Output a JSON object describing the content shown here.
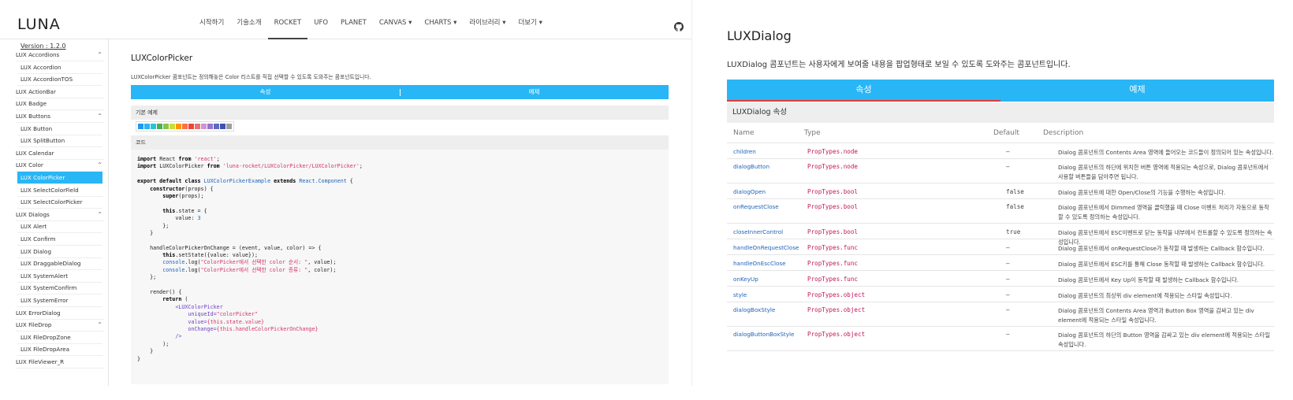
{
  "left": {
    "logo": "LUNA",
    "nav": [
      "시작하기",
      "기술소개",
      "ROCKET",
      "UFO",
      "PLANET",
      "CANVAS ▾",
      "CHARTS ▾",
      "라이브러리 ▾",
      "더보기 ▾"
    ],
    "nav_active_index": 2,
    "version": "Version : 1.2.0",
    "sidebar": [
      {
        "label": "LUX Accordions",
        "child": false,
        "chevron": "⌃"
      },
      {
        "label": "LUX Accordion",
        "child": true
      },
      {
        "label": "LUX AccordionTOS",
        "child": true
      },
      {
        "label": "LUX ActionBar",
        "child": false
      },
      {
        "label": "LUX Badge",
        "child": false
      },
      {
        "label": "LUX Buttons",
        "child": false,
        "chevron": "⌃"
      },
      {
        "label": "LUX Button",
        "child": true
      },
      {
        "label": "LUX SplitButton",
        "child": true
      },
      {
        "label": "LUX Calendar",
        "child": false
      },
      {
        "label": "LUX Color",
        "child": false,
        "chevron": "⌃"
      },
      {
        "label": "LUX ColorPicker",
        "child": true,
        "active": true
      },
      {
        "label": "LUX SelectColorField",
        "child": true
      },
      {
        "label": "LUX SelectColorPicker",
        "child": true
      },
      {
        "label": "LUX Dialogs",
        "child": false,
        "chevron": "⌃"
      },
      {
        "label": "LUX Alert",
        "child": true
      },
      {
        "label": "LUX Confirm",
        "child": true
      },
      {
        "label": "LUX Dialog",
        "child": true
      },
      {
        "label": "LUX DraggableDialog",
        "child": true
      },
      {
        "label": "LUX SystemAlert",
        "child": true
      },
      {
        "label": "LUX SystemConfirm",
        "child": true
      },
      {
        "label": "LUX SystemError",
        "child": true
      },
      {
        "label": "LUX ErrorDialog",
        "child": false
      },
      {
        "label": "LUX FileDrop",
        "child": false,
        "chevron": "⌃"
      },
      {
        "label": "LUX FileDropZone",
        "child": true
      },
      {
        "label": "LUX FileDropArea",
        "child": true
      },
      {
        "label": "LUX FileViewer_R",
        "child": false
      }
    ],
    "content": {
      "title": "LUXColorPicker",
      "description": "LUXColorPicker 콤포넌트는 정의해놓은 Color 리스트를 직접 선택할 수 있도록 도와주는 콤포넌트입니다.",
      "tab_props": "속성",
      "tab_example": "예제",
      "basic_example": "기본 예제",
      "code_label": "코드",
      "swatch_colors": [
        "#2196f3",
        "#29b6f6",
        "#26c6da",
        "#4caf50",
        "#8bc34a",
        "#cddc39",
        "#ff9800",
        "#ff7043",
        "#f44336",
        "#e57373",
        "#ce93d8",
        "#9575cd",
        "#5c6bc0",
        "#3f51b5",
        "#9e9e9e"
      ],
      "code_lines": [
        [
          [
            "k",
            "import"
          ],
          [
            "t",
            " React "
          ],
          [
            "k",
            "from"
          ],
          [
            "s",
            " 'react'"
          ],
          [
            "t",
            ";"
          ]
        ],
        [
          [
            "k",
            "import"
          ],
          [
            "t",
            " LUXColorPicker "
          ],
          [
            "k",
            "from"
          ],
          [
            "s",
            " 'luna-rocket/LUXColorPicker/LUXColorPicker'"
          ],
          [
            "t",
            ";"
          ]
        ],
        [],
        [
          [
            "k",
            "export default class"
          ],
          [
            "c",
            " LUXColorPickerExample "
          ],
          [
            "k",
            "extends"
          ],
          [
            "c",
            " React.Component"
          ],
          [
            "t",
            " {"
          ]
        ],
        [
          [
            "t",
            "    "
          ],
          [
            "k",
            "constructor"
          ],
          [
            "t",
            "(props) {"
          ]
        ],
        [
          [
            "t",
            "        "
          ],
          [
            "k",
            "super"
          ],
          [
            "t",
            "(props);"
          ]
        ],
        [],
        [
          [
            "t",
            "        "
          ],
          [
            "k",
            "this"
          ],
          [
            "t",
            ".state = {"
          ]
        ],
        [
          [
            "t",
            "            value: "
          ],
          [
            "c",
            "3"
          ]
        ],
        [
          [
            "t",
            "        };"
          ]
        ],
        [
          [
            "t",
            "    }"
          ]
        ],
        [],
        [
          [
            "t",
            "    handleColorPickerOnChange = (event, value, color) => {"
          ]
        ],
        [
          [
            "t",
            "        "
          ],
          [
            "k",
            "this"
          ],
          [
            "t",
            ".setState({value: value});"
          ]
        ],
        [
          [
            "t",
            "        "
          ],
          [
            "c",
            "console"
          ],
          [
            "t",
            ".log("
          ],
          [
            "s",
            "\"ColorPicker에서 선택한 color 순서: \""
          ],
          [
            "t",
            ", value);"
          ]
        ],
        [
          [
            "t",
            "        "
          ],
          [
            "c",
            "console"
          ],
          [
            "t",
            ".log("
          ],
          [
            "s",
            "\"ColorPicker에서 선택한 color 종류: \""
          ],
          [
            "t",
            ", color);"
          ]
        ],
        [
          [
            "t",
            "    };"
          ]
        ],
        [],
        [
          [
            "t",
            "    render() {"
          ]
        ],
        [
          [
            "t",
            "        "
          ],
          [
            "k",
            "return"
          ],
          [
            "t",
            " ("
          ]
        ],
        [
          [
            "t",
            "            "
          ],
          [
            "g",
            "<LUXColorPicker"
          ]
        ],
        [
          [
            "t",
            "                "
          ],
          [
            "p",
            "uniqueId="
          ],
          [
            "s",
            "\"colorPicker\""
          ]
        ],
        [
          [
            "t",
            "                "
          ],
          [
            "p",
            "value="
          ],
          [
            "s",
            "{this.state.value}"
          ]
        ],
        [
          [
            "t",
            "                "
          ],
          [
            "p",
            "onChange="
          ],
          [
            "s",
            "{this.handleColorPickerOnChange}"
          ]
        ],
        [
          [
            "t",
            "            "
          ],
          [
            "g",
            "/>"
          ]
        ],
        [
          [
            "t",
            "        );"
          ]
        ],
        [
          [
            "t",
            "    }"
          ]
        ],
        [
          [
            "t",
            "}"
          ]
        ]
      ]
    }
  },
  "right": {
    "title": "LUXDialog",
    "description": "LUXDialog 콤포넌트는 사용자에게 보여줄 내용을 팝업형태로 보일 수 있도록 도와주는 콤포넌트입니다.",
    "tab_props": "속성",
    "tab_example": "예제",
    "section": "LUXDialog 속성",
    "headers": {
      "name": "Name",
      "type": "Type",
      "default": "Default",
      "description": "Description"
    },
    "rows": [
      {
        "name": "children",
        "type": "PropTypes.node",
        "default": "–",
        "desc": "Dialog 콤포넌트의 Contents Area 영역에 들어오는 코드들이 정의되어 있는 속성입니다."
      },
      {
        "name": "dialogButton",
        "type": "PropTypes.node",
        "default": "–",
        "desc": "Dialog 콤포넌트의 하단에 위치한 버튼 영역에 적용되는 속성으로, Dialog 콤포넌트에서 사용할 버튼들을 담아주면 됩니다."
      },
      {
        "name": "dialogOpen",
        "type": "PropTypes.bool",
        "default": "false",
        "desc": "Dialog 콤포넌트에 대한 Open/Close의 기능을 수행하는 속성입니다."
      },
      {
        "name": "onRequestClose",
        "type": "PropTypes.bool",
        "default": "false",
        "desc": "Dialog 콤포넌트에서 Dimmed 영역을 클릭했을 때 Close 이벤트 처리가 자동으로 동작할 수 있도록 정의하는 속성입니다."
      },
      {
        "name": "closeInnerControl",
        "type": "PropTypes.bool",
        "default": "true",
        "desc": "Dialog 콤포넌트에서 ESC이벤트로 닫는 동작을 내부에서 컨트롤할 수 있도록 정의하는 속성입니다."
      },
      {
        "name": "handleOnRequestClose",
        "type": "PropTypes.func",
        "default": "–",
        "desc": "Dialog 콤포넌트에서 onRequestClose가 동작할 때 발생하는 Callback 함수입니다."
      },
      {
        "name": "handleOnEscClose",
        "type": "PropTypes.func",
        "default": "–",
        "desc": "Dialog 콤포넌트에서 ESC키를 통해 Close 동작할 때 발생하는 Callback 함수입니다."
      },
      {
        "name": "onKeyUp",
        "type": "PropTypes.func",
        "default": "–",
        "desc": "Dialog 콤포넌트에서 Key Up이 동작할 때 발생하는 Callback 함수입니다."
      },
      {
        "name": "style",
        "type": "PropTypes.object",
        "default": "–",
        "desc": "Dialog 콤포넌트의 최상위 div element에 적용되는 스타일 속성입니다."
      },
      {
        "name": "dialogBoxStyle",
        "type": "PropTypes.object",
        "default": "–",
        "desc": "Dialog 콤포넌트의 Contents Area 영역과 Button Box 영역을 감싸고 있는 div element에 적용되는 스타일 속성입니다."
      },
      {
        "name": "dialogButtonBoxStyle",
        "type": "PropTypes.object",
        "default": "–",
        "desc": "Dialog 콤포넌트의 하단의 Button 영역을 감싸고 있는 div element에 적용되는 스타일 속성입니다."
      }
    ]
  }
}
